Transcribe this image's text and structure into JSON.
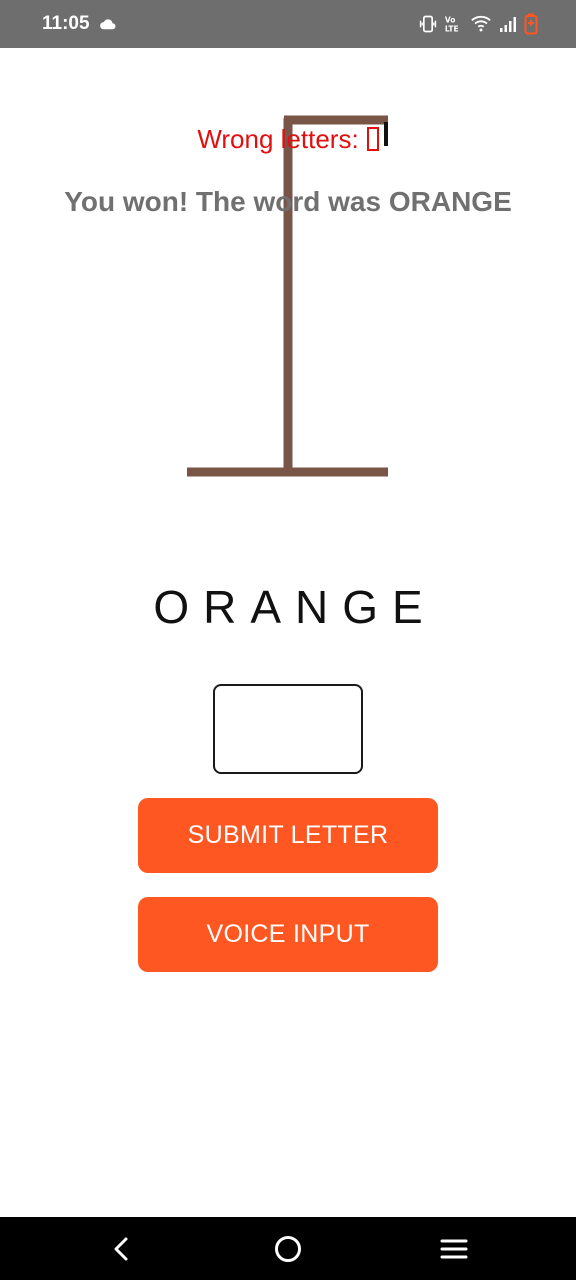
{
  "status_bar": {
    "time": "11:05",
    "icons": [
      "cloud-icon",
      "vibrate-icon",
      "volte-icon",
      "wifi-icon",
      "signal-icon",
      "battery-low-icon"
    ],
    "battery_color": "#ff5722"
  },
  "game": {
    "wrong_letters_label": "Wrong letters:",
    "result_message": "You won! The word was ORANGE",
    "word": "ORANGE",
    "gallows_color": "#795548",
    "wrong_color": "#e01010"
  },
  "input": {
    "value": "",
    "placeholder": ""
  },
  "buttons": {
    "submit_label": "SUBMIT LETTER",
    "voice_label": "VOICE INPUT",
    "color": "#ff5722"
  },
  "nav": {
    "items": [
      "back-icon",
      "home-icon",
      "recents-icon"
    ]
  }
}
